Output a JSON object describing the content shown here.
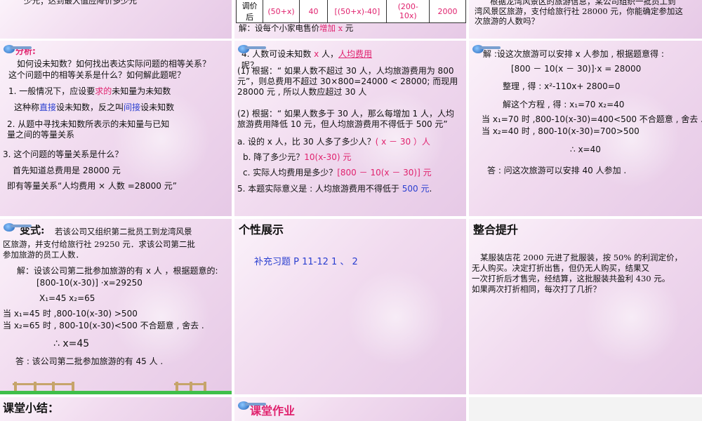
{
  "slide_tl": {
    "text": "少元；达到最大值应降价多少元"
  },
  "slide_tm": {
    "row_label": "调价后",
    "cells": [
      "(50+x)",
      "40",
      "[(50+x)-40]",
      "(200-10x)",
      "2000"
    ],
    "solve_prefix": "解：设每个小家电售价",
    "solve_red": "增加 x",
    "solve_suffix": " 元"
  },
  "slide_tr": {
    "lines": [
      "根据龙湾风景区的旅游信息，某公司组织一批员工到",
      "湾风景区旅游，支付给旅行社 28000 元，你能确定参加这",
      "次旅游的人数吗？"
    ]
  },
  "slide_ml": {
    "title": "分析:",
    "q1": "如何设未知数？如何找出表达实际问题的相等关系？",
    "q2": "这个问题中的相等关系是什么？如何解此题呢？",
    "p1_a": "1. 一般情况下，应设要",
    "p1_red": "求的",
    "p1_b": "未知量为未知数",
    "p2_a": "这种称",
    "p2_blue1": "直接",
    "p2_b": "设未知数，反之叫",
    "p2_blue2": "间接",
    "p2_c": "设未知数",
    "p3_1": "2. 从题中寻找未知数所表示的未知量与已知",
    "p3_2": "量之间的等量关系",
    "p4": "3. 这个问题的等量关系是什么？",
    "p5": "首先知道总费用是 28000 元",
    "p6": "即有等量关系“人均费用 × 人数 =28000 元”"
  },
  "slide_mm": {
    "h_a": "4. 人数可设未知数 ",
    "h_red1": "x",
    "h_b": " 人，",
    "h_red2": "人均费用",
    "h_c": "呢？",
    "p1": "(1) 根据：“ 如果人数不超过 30 人，人均旅游费用为 800 元”，则总费用不超过 30×800=24000 < 28000; 而现用 28000 元 , 所以人数应超过 30 人",
    "p2": "(2) 根据：“ 如果人数多于 30 人，那么每增加 1 人，人均旅游费用降低 10 元，但人均旅游费用不得低于 500 元”",
    "a_pre": "a. 设的 x 人，比 30 人多了多少人？",
    "a_red": "( x － 30 ）人",
    "b_pre": "b. 降了多少元？",
    "b_red": "10(x-30) 元",
    "c_pre": "c. 实际人均费用是多少？",
    "c_red": "[800 － 10(x － 30)] 元",
    "p5_a": "5. 本题实际意义是 : 人均旅游费用不得低于 ",
    "p5_blue": "500 元",
    "p5_b": "."
  },
  "slide_mr": {
    "l1": "解 :设这次旅游可以安排 x 人参加 , 根据题意得 :",
    "l2": "[800 － 10(x － 30)]·x = 28000",
    "l3": "整理 , 得 :     x²-110x+ 2800=0",
    "l4": "解这个方程 , 得 :     x₁=70       x₂=40",
    "l5": "当 x₁=70 时 ,800-10(x-30)=400<500       不合题意 , 舍去 .",
    "l6": "当 x₂=40 时 , 800-10(x-30)=700>500",
    "l7": "∴ x=40",
    "l8": "答 : 问这次旅游可以安排 40 人参加 ."
  },
  "slide_bl": {
    "title": "变式:",
    "t1": "若该公司又组织第二批员工到龙湾风景",
    "t2": "区旅游，并支付给旅行社 29250 元．求该公司第二批",
    "t3": "参加旅游的员工人数．",
    "l1": "解：设该公司第二批参加旅游的有 x 人 ，根据题意的:",
    "l2": "[800-10(x-30)] ·x=29250",
    "l3": "X₁=45         x₂=65",
    "l4": "当 x₁=45 时 ,800-10(x-30) >500",
    "l5": "当 x₂=65 时 , 800-10(x-30)<500 不合题意 , 舍去 .",
    "l6": "∴ x=45",
    "l7": "答 : 该公司第二批参加旅游的有 45 人 ."
  },
  "slide_bm": {
    "title": "个性展示",
    "line": "补充习题    P 11-12       1 、 2"
  },
  "slide_br": {
    "title": "整合提升",
    "l1": "某服装店花 2000 元进了批服装，按 50% 的利润定价，",
    "l2": "无人购买。决定打折出售，但仍无人购买，结果又",
    "l3": "一次打折后才售完，经结算，这批服装共盈利 430 元。",
    "l4": "如果两次打折相同，每次打了几折？"
  },
  "slide_xl": {
    "title": "课堂小结："
  },
  "slide_xm": {
    "title": "课堂作业"
  },
  "colors": {
    "red": "#e0226e",
    "blue": "#2a3fd0",
    "slide_bg": "#f1dbef"
  }
}
